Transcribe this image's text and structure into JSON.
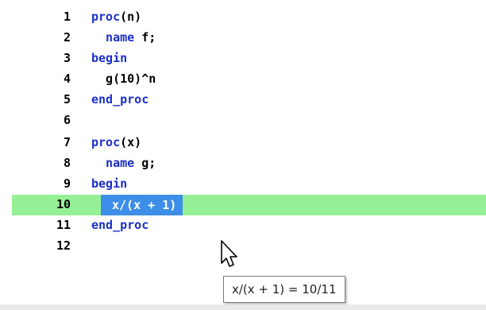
{
  "lines": [
    {
      "number": "1",
      "parts": [
        {
          "t": "proc",
          "c": "kw"
        },
        {
          "t": "(n)",
          "c": "tx"
        }
      ]
    },
    {
      "number": "2",
      "parts": [
        {
          "t": "  name ",
          "c": "kw"
        },
        {
          "t": "f;",
          "c": "tx"
        }
      ]
    },
    {
      "number": "3",
      "parts": [
        {
          "t": "begin",
          "c": "kw"
        }
      ]
    },
    {
      "number": "4",
      "parts": [
        {
          "t": "  g(10)^n",
          "c": "tx"
        }
      ]
    },
    {
      "number": "5",
      "parts": [
        {
          "t": "end_proc",
          "c": "kw"
        }
      ]
    },
    {
      "number": "6",
      "parts": []
    },
    {
      "number": "7",
      "parts": [
        {
          "t": "proc",
          "c": "kw"
        },
        {
          "t": "(x)",
          "c": "tx"
        }
      ]
    },
    {
      "number": "8",
      "parts": [
        {
          "t": "  name ",
          "c": "kw"
        },
        {
          "t": "g;",
          "c": "tx"
        }
      ]
    },
    {
      "number": "9",
      "parts": [
        {
          "t": "begin",
          "c": "kw"
        }
      ]
    },
    {
      "number": "10",
      "parts": [
        {
          "t": "x/(x + 1)",
          "c": "sel"
        }
      ],
      "current": true
    },
    {
      "number": "11",
      "parts": [
        {
          "t": "end_proc",
          "c": "kw"
        }
      ]
    },
    {
      "number": "12",
      "parts": []
    }
  ],
  "tooltip": {
    "text": "x/(x + 1) = 10/11"
  },
  "colors": {
    "keyword": "#1c2fc5",
    "current_line": "#95f095",
    "selection": "#3d8ee8"
  },
  "icons": {
    "cursor": "mouse-pointer-icon"
  }
}
